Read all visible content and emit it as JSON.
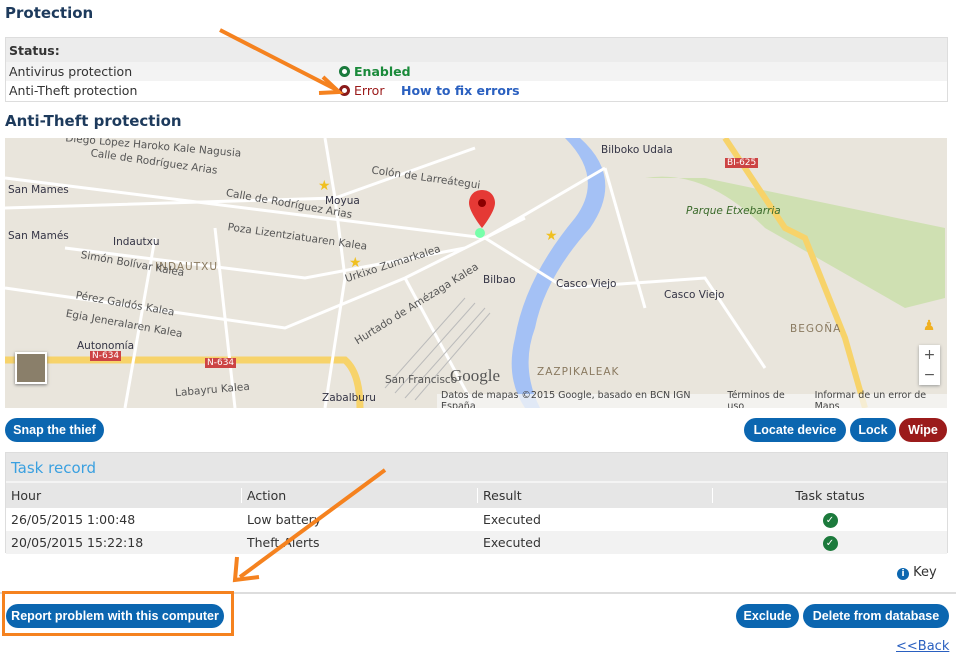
{
  "protection": {
    "title": "Protection",
    "status_label": "Status:",
    "rows": [
      {
        "name": "Antivirus protection",
        "status": "Enabled",
        "color": "#1a8a3a"
      },
      {
        "name": "Anti-Theft protection",
        "status": "Error",
        "color": "#9b1b1b",
        "link": "How to fix errors"
      }
    ]
  },
  "antitheft": {
    "title": "Anti-Theft protection",
    "map": {
      "labels": [
        "Calle de Rodríguez Arias",
        "San Mamés",
        "Moyua",
        "Indautxu",
        "INDAUTXU",
        "Bilbao",
        "Casco Viejo",
        "Casco Viejo",
        "Parque Etxebarria",
        "Autonomía",
        "Zabalburu",
        "ZAZPIKALEAK",
        "BEGOÑA",
        "Hurtado de Amézaga Kalea",
        "Bilboko Udala",
        "Colón de Larreátegui",
        "Urkixo Zumarkalea",
        "Pozа Lizentziatuaren Kalea",
        "Simón Bolívar Kalea",
        "Pérez Galdós Kalea",
        "Egia Jeneralaren Kalea",
        "Labayru Kalea",
        "Diego López Haroko Kale Nagusia",
        "Calle de Rodríguez Arias",
        "San Mames",
        "San Francisco"
      ],
      "road_badges": [
        "N-634",
        "N-634",
        "BI-625"
      ],
      "google": "Google",
      "attribution": "Datos de mapas ©2015 Google, basado en BCN IGN España",
      "terms": "Términos de uso",
      "report": "Informar de un error de Maps",
      "zoom_in": "+",
      "zoom_out": "−"
    },
    "buttons": {
      "snap": "Snap the thief",
      "locate": "Locate device",
      "lock": "Lock",
      "wipe": "Wipe"
    }
  },
  "task_record": {
    "title": "Task record",
    "columns": [
      "Hour",
      "Action",
      "Result",
      "Task status"
    ],
    "rows": [
      {
        "hour": "26/05/2015 1:00:48",
        "action": "Low battery",
        "result": "Executed",
        "status": "✓"
      },
      {
        "hour": "20/05/2015 15:22:18",
        "action": "Theft Alerts",
        "result": "Executed",
        "status": "✓"
      }
    ]
  },
  "key": "Key",
  "footer": {
    "report": "Report problem with this computer",
    "exclude": "Exclude",
    "delete": "Delete from database",
    "back": "<<Back"
  },
  "colors": {
    "accent": "#0b66b0",
    "wipe": "#9b1b1b",
    "annotation": "#f5821f"
  }
}
